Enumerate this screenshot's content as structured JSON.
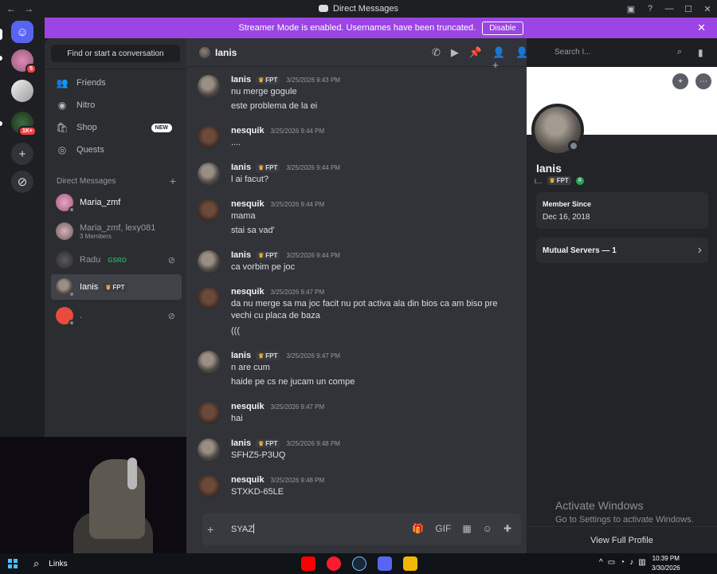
{
  "window": {
    "title": "Direct Messages",
    "back_glyph": "←",
    "forward_glyph": "→",
    "controls": [
      "▣",
      "?",
      "—",
      "☐",
      "✕"
    ]
  },
  "servers": [
    {
      "name": "home",
      "glyph": "☺"
    },
    {
      "name": "server-1",
      "badge": "5"
    },
    {
      "name": "server-2"
    },
    {
      "name": "server-3",
      "badge": "1K+"
    },
    {
      "name": "add-server",
      "glyph": "+"
    },
    {
      "name": "discover",
      "glyph": "⊘"
    }
  ],
  "banner": {
    "text": "Streamer Mode is enabled. Usernames have been truncated.",
    "button": "Disable",
    "close": "✕"
  },
  "sidebar": {
    "find_placeholder": "Find or start a conversation",
    "nav": [
      {
        "label": "Friends",
        "icon": "friends-icon",
        "glyph": "👥"
      },
      {
        "label": "Nitro",
        "icon": "nitro-icon",
        "glyph": "◉"
      },
      {
        "label": "Shop",
        "icon": "shop-icon",
        "glyph": "🛍",
        "badge": "NEW"
      },
      {
        "label": "Quests",
        "icon": "quests-icon",
        "glyph": "◎"
      }
    ],
    "dm_header": "Direct Messages",
    "dm_add": "+",
    "dms": [
      {
        "name": "Maria_zmf"
      },
      {
        "name": "Maria_zmf, lexy081",
        "sub": "3 Members"
      },
      {
        "name": "Radu",
        "tag": "GSRO",
        "blocked": "⊘"
      },
      {
        "name": "Ianis",
        "tag": "FPT"
      },
      {
        "name": ".",
        "blocked": "⊘"
      }
    ]
  },
  "chat": {
    "header_name": "Ianis",
    "header_tools": [
      "✆",
      "▶",
      "📌",
      "👤+",
      "👤"
    ],
    "search_placeholder": "Search I...",
    "search_icon": "⌕",
    "inbox_icon": "▮",
    "messages": [
      {
        "author": "Ianis",
        "tag": "FPT",
        "time": "3/25/2026 9:43 PM",
        "lines": [
          "nu merge gogule",
          "este problema de la ei"
        ]
      },
      {
        "author": "nesquik",
        "time": "3/25/2026 9:44 PM",
        "lines": [
          "...."
        ]
      },
      {
        "author": "Ianis",
        "tag": "FPT",
        "time": "3/25/2026 9:44 PM",
        "lines": [
          "l ai facut?"
        ]
      },
      {
        "author": "nesquik",
        "time": "3/25/2026 9:44 PM",
        "lines": [
          "mama",
          "stai sa vad'"
        ]
      },
      {
        "author": "Ianis",
        "tag": "FPT",
        "time": "3/25/2026 9:44 PM",
        "lines": [
          "ca vorbim pe joc"
        ]
      },
      {
        "author": "nesquik",
        "time": "3/25/2026 9:47 PM",
        "lines": [
          "da nu merge sa ma joc facit nu pot activa ala din bios ca am biso pre vechi cu placa de baza",
          "((("
        ]
      },
      {
        "author": "Ianis",
        "tag": "FPT",
        "time": "3/25/2026 9:47 PM",
        "lines": [
          "n are cum",
          "haide pe cs ne jucam un compe"
        ]
      },
      {
        "author": "nesquik",
        "time": "3/25/2026 9:47 PM",
        "lines": [
          "hai"
        ]
      },
      {
        "author": "Ianis",
        "tag": "FPT",
        "time": "3/25/2026 9:48 PM",
        "lines": [
          "SFHZ5-P3UQ"
        ]
      },
      {
        "author": "nesquik",
        "time": "3/25/2026 9:48 PM",
        "lines": [
          "STXKD-65LE"
        ]
      }
    ],
    "composer_value": "SYAZ",
    "composer_plus": "+",
    "composer_tools": [
      "🎁",
      "GIF",
      "▦",
      "☺",
      "✚"
    ]
  },
  "profile": {
    "name": "Ianis",
    "handle": "i...",
    "tag": "FPT",
    "member_since_label": "Member Since",
    "member_since": "Dec 16, 2018",
    "mutual_servers": "Mutual Servers — 1",
    "chevron": "›",
    "activate_title": "Activate Windows",
    "activate_sub": "Go to Settings to activate Windows.",
    "view_full_profile": "View Full Profile",
    "add_friend_glyph": "+",
    "more_glyph": "⋯"
  },
  "taskbar": {
    "search_label": "Links",
    "time": "10:39 PM",
    "date": "3/30/2026",
    "tray": [
      "^",
      "▭",
      "◔",
      "♪",
      "▥"
    ],
    "apps": [
      {
        "name": "youtube",
        "color": "#ff0000"
      },
      {
        "name": "opera",
        "color": "#ff1b2d"
      },
      {
        "name": "steam",
        "color": "#1b2838"
      },
      {
        "name": "discord",
        "color": "#5865f2"
      },
      {
        "name": "app",
        "color": "#f2b705"
      }
    ]
  },
  "colors": {
    "accent": "#5865f2",
    "banner": "#9b45e4",
    "online": "#23a55a",
    "badge": "#f23f43"
  }
}
